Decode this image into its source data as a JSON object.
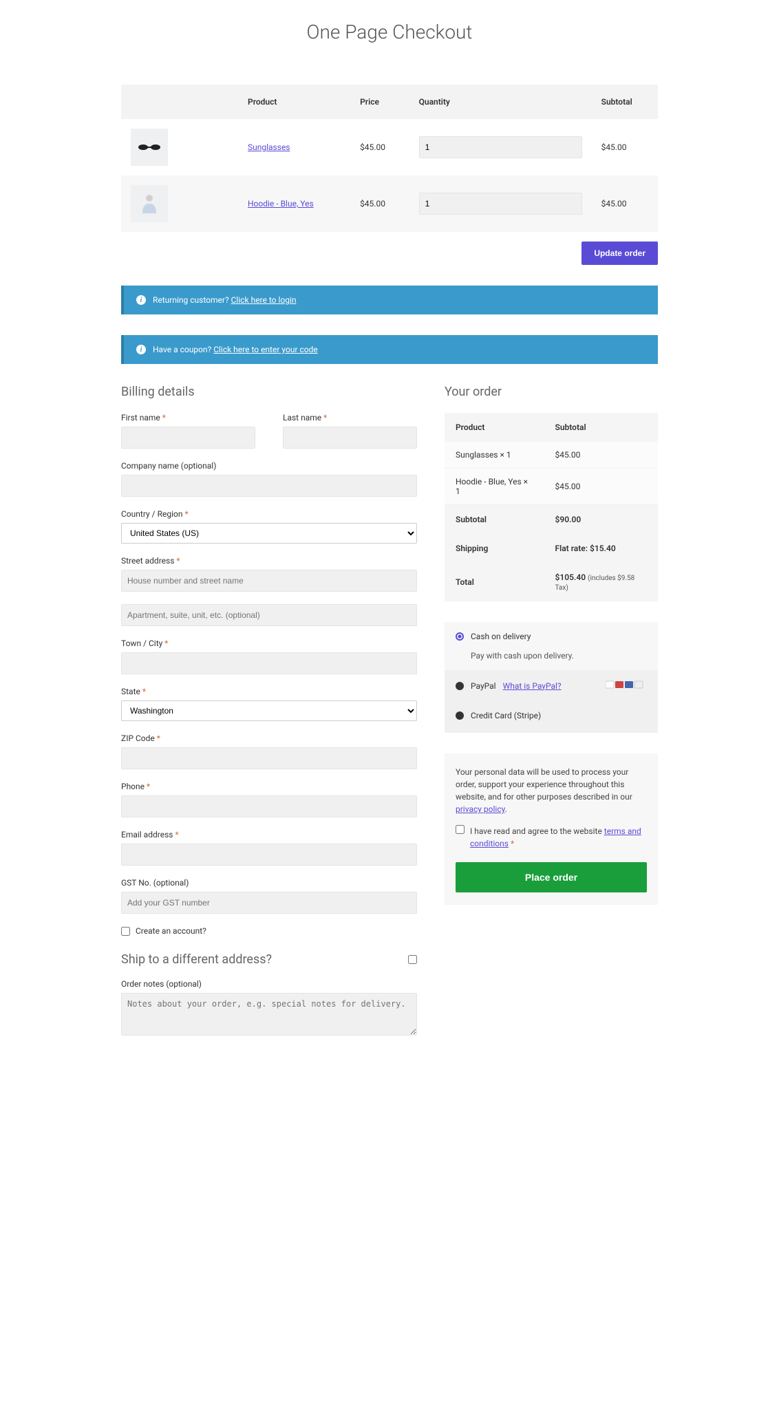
{
  "title": "One Page Checkout",
  "table": {
    "headers": {
      "product": "Product",
      "price": "Price",
      "quantity": "Quantity",
      "subtotal": "Subtotal"
    },
    "items": [
      {
        "name": "Sunglasses",
        "price": "$45.00",
        "qty": "1",
        "subtotal": "$45.00"
      },
      {
        "name": "Hoodie - Blue, Yes",
        "price": "$45.00",
        "qty": "1",
        "subtotal": "$45.00"
      }
    ]
  },
  "update_btn": "Update order",
  "notice_login": {
    "prefix": "Returning customer? ",
    "link": "Click here to login"
  },
  "notice_coupon": {
    "prefix": "Have a coupon? ",
    "link": "Click here to enter your code"
  },
  "billing": {
    "heading": "Billing details",
    "first_name": "First name",
    "last_name": "Last name",
    "company": "Company name (optional)",
    "country": "Country / Region",
    "country_value": "United States (US)",
    "street": "Street address",
    "street_ph": "House number and street name",
    "street2_ph": "Apartment, suite, unit, etc. (optional)",
    "city": "Town / City",
    "state": "State",
    "state_value": "Washington",
    "zip": "ZIP Code",
    "phone": "Phone",
    "email": "Email address",
    "gst": "GST No. (optional)",
    "gst_ph": "Add your GST number",
    "create_account": "Create an account?"
  },
  "ship": {
    "heading": "Ship to a different address?",
    "notes_label": "Order notes (optional)",
    "notes_ph": "Notes about your order, e.g. special notes for delivery."
  },
  "order": {
    "heading": "Your order",
    "col_product": "Product",
    "col_subtotal": "Subtotal",
    "lines": [
      {
        "name": "Sunglasses  × 1",
        "amount": "$45.00"
      },
      {
        "name": "Hoodie - Blue, Yes  × 1",
        "amount": "$45.00"
      }
    ],
    "subtotal_label": "Subtotal",
    "subtotal": "$90.00",
    "shipping_label": "Shipping",
    "shipping": "Flat rate: $15.40",
    "total_label": "Total",
    "total": "$105.40",
    "tax_note": "(includes $9.58 Tax)"
  },
  "pay": {
    "cod": "Cash on delivery",
    "cod_desc": "Pay with cash upon delivery.",
    "paypal": "PayPal",
    "paypal_link": "What is PayPal?",
    "stripe": "Credit Card (Stripe)"
  },
  "terms": {
    "text": "Your personal data will be used to process your order, support your experience throughout this website, and for other purposes described in our ",
    "privacy": "privacy policy",
    "agree_prefix": "I have read and agree to the website ",
    "tc": "terms and conditions"
  },
  "place_order": "Place order"
}
